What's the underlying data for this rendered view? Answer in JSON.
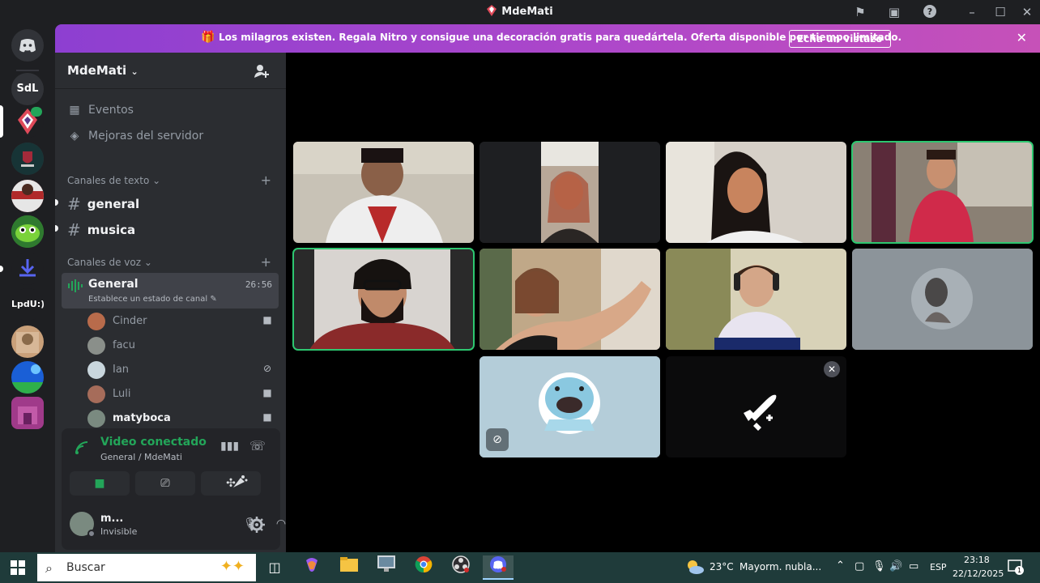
{
  "window": {
    "title": "MdeMati"
  },
  "guilds": {
    "items": [
      {
        "label": "SdL",
        "kind": "text"
      },
      {
        "label": "LpdU:)",
        "kind": "text"
      }
    ]
  },
  "banner": {
    "message": "Los milagros existen. Regala Nitro y consigue una decoración gratis para quedártela. Oferta disponible por tiempo limitado.",
    "button_label": "Echa un vistazo"
  },
  "sidebar": {
    "server_name": "MdeMati",
    "events_label": "Eventos",
    "boosts_label": "Mejoras del servidor",
    "text_category": "Canales de texto",
    "text_channels": [
      "general",
      "musica"
    ],
    "voice_category": "Canales de voz",
    "voice_channel": {
      "name": "General",
      "status": "Establece un estado de canal",
      "time": "26:56"
    },
    "members": [
      {
        "name": "Cinder",
        "icon": "video-icon",
        "color": "#b86b4b"
      },
      {
        "name": "facu",
        "icon": "",
        "color": "#8a8f8a"
      },
      {
        "name": "Ian",
        "icon": "mic-muted-icon",
        "color": "#c9d6dd"
      },
      {
        "name": "Luli",
        "icon": "video-icon",
        "color": "#a66c5a"
      },
      {
        "name": "matyboca",
        "icon": "video-icon",
        "color": "#7a8a80"
      }
    ]
  },
  "voice_panel": {
    "status": "Video conectado",
    "location": "General / MdeMati",
    "user_name": "m...",
    "user_status": "Invisible"
  },
  "taskbar": {
    "search_placeholder": "Buscar",
    "weather_temp": "23°C",
    "weather_text": "Mayorm. nubla...",
    "language": "ESP",
    "time": "23:18",
    "date": "22/12/2025",
    "notification_count": "1"
  },
  "colors": {
    "accent_green": "#23a559",
    "speaking_outline": "#2dc770",
    "banner_start": "#8d3fd1",
    "banner_end": "#c651b8"
  }
}
